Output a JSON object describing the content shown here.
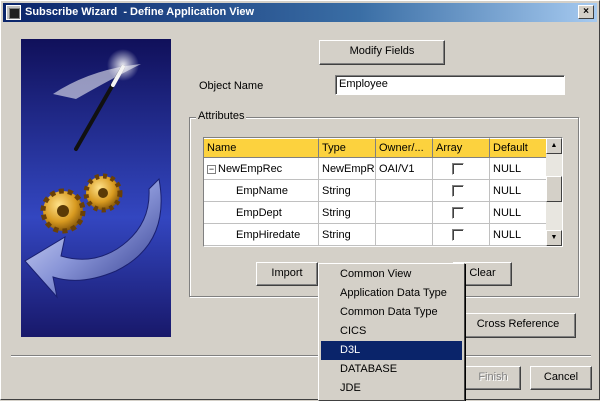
{
  "window": {
    "title": "Subscribe Wizard  - Define Application View",
    "close_label": "×"
  },
  "form": {
    "modify_fields_label": "Modify Fields",
    "object_name_label": "Object Name",
    "object_name_value": "Employee"
  },
  "attributes": {
    "group_label": "Attributes",
    "columns": [
      "Name",
      "Type",
      "Owner/...",
      "Array",
      "Default"
    ],
    "rows": [
      {
        "name": "NewEmpRec",
        "type": "NewEmpRec",
        "owner": "OAI/V1",
        "array_checked": false,
        "default": "NULL",
        "expandable": true,
        "expand_glyph": "−"
      },
      {
        "name": "EmpName",
        "type": "String",
        "owner": "",
        "array_checked": false,
        "default": "NULL",
        "expandable": false
      },
      {
        "name": "EmpDept",
        "type": "String",
        "owner": "",
        "array_checked": false,
        "default": "NULL",
        "expandable": false
      },
      {
        "name": "EmpHiredate",
        "type": "String",
        "owner": "",
        "array_checked": false,
        "default": "NULL",
        "expandable": false
      }
    ],
    "import_label": "Import",
    "clear_label": "Clear"
  },
  "dropdown": {
    "selected": "D3L",
    "items": [
      "Common View",
      "Application Data Type",
      "Common Data Type",
      "CICS",
      "D3L",
      "DATABASE",
      "JDE"
    ]
  },
  "buttons": {
    "cross_reference_label": "Cross Reference",
    "finish_label": "Finish",
    "cancel_label": "Cancel"
  },
  "colors": {
    "header_bg": "#fcd23e",
    "selection_bg": "#0a246a",
    "banner_blue": "#2b3aa8"
  }
}
